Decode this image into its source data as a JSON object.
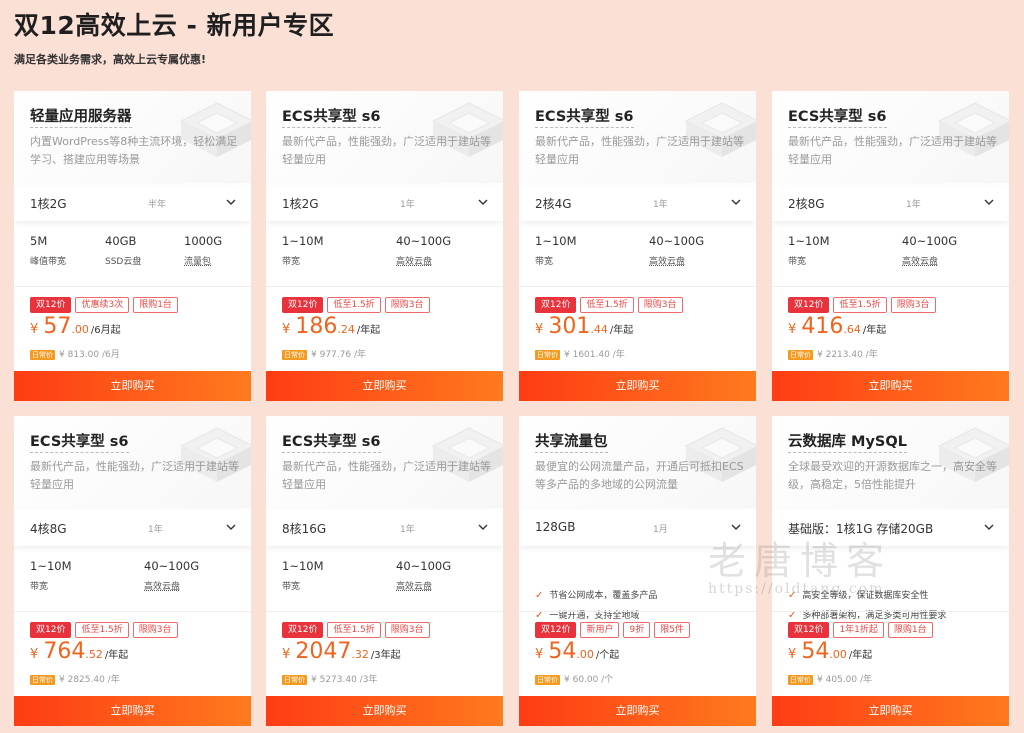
{
  "header": {
    "title": "双12高效上云 - 新用户专区",
    "subtitle": "满足各类业务需求，高效上云专属优惠!"
  },
  "buy_label": "立即购买",
  "orig_badge": "日常价",
  "colors": {
    "accent": "#f0641e",
    "tag_red": "#e8323c",
    "button_start": "#ff3c14",
    "button_end": "#ff7a1e",
    "background": "#fbe0d6"
  },
  "cards": [
    {
      "name": "轻量应用服务器",
      "desc": "内置WordPress等8种主流环境，轻松满足学习、搭建应用等场景",
      "spec": "1核2G",
      "duration": "半年",
      "specs": [
        {
          "v": "5M",
          "l": "峰值带宽"
        },
        {
          "v": "40GB",
          "l": "SSD云盘"
        },
        {
          "v": "1000G",
          "l": "流量包"
        }
      ],
      "tags": [
        "双12价",
        "优惠续3次",
        "限购1台"
      ],
      "price_cur": "¥",
      "price_int": "57",
      "price_dec": ".00",
      "price_unit": "/6月起",
      "orig": "¥ 813.00 /6月"
    },
    {
      "name": "ECS共享型 s6",
      "desc": "最新代产品，性能强劲，广泛适用于建站等轻量应用",
      "spec": "1核2G",
      "duration": "1年",
      "specs": [
        {
          "v": "1~10M",
          "l": "带宽"
        },
        {
          "v": "40~100G",
          "l": "高效云盘"
        }
      ],
      "tags": [
        "双12价",
        "低至1.5折",
        "限购3台"
      ],
      "price_cur": "¥",
      "price_int": "186",
      "price_dec": ".24",
      "price_unit": "/年起",
      "orig": "¥ 977.76 /年"
    },
    {
      "name": "ECS共享型 s6",
      "desc": "最新代产品，性能强劲，广泛适用于建站等轻量应用",
      "spec": "2核4G",
      "duration": "1年",
      "specs": [
        {
          "v": "1~10M",
          "l": "带宽"
        },
        {
          "v": "40~100G",
          "l": "高效云盘"
        }
      ],
      "tags": [
        "双12价",
        "低至1.5折",
        "限购3台"
      ],
      "price_cur": "¥",
      "price_int": "301",
      "price_dec": ".44",
      "price_unit": "/年起",
      "orig": "¥ 1601.40 /年"
    },
    {
      "name": "ECS共享型 s6",
      "desc": "最新代产品，性能强劲，广泛适用于建站等轻量应用",
      "spec": "2核8G",
      "duration": "1年",
      "specs": [
        {
          "v": "1~10M",
          "l": "带宽"
        },
        {
          "v": "40~100G",
          "l": "高效云盘"
        }
      ],
      "tags": [
        "双12价",
        "低至1.5折",
        "限购3台"
      ],
      "price_cur": "¥",
      "price_int": "416",
      "price_dec": ".64",
      "price_unit": "/年起",
      "orig": "¥ 2213.40 /年"
    },
    {
      "name": "ECS共享型 s6",
      "desc": "最新代产品，性能强劲，广泛适用于建站等轻量应用",
      "spec": "4核8G",
      "duration": "1年",
      "specs": [
        {
          "v": "1~10M",
          "l": "带宽"
        },
        {
          "v": "40~100G",
          "l": "高效云盘"
        }
      ],
      "tags": [
        "双12价",
        "低至1.5折",
        "限购3台"
      ],
      "price_cur": "¥",
      "price_int": "764",
      "price_dec": ".52",
      "price_unit": "/年起",
      "orig": "¥ 2825.40 /年"
    },
    {
      "name": "ECS共享型 s6",
      "desc": "最新代产品，性能强劲，广泛适用于建站等轻量应用",
      "spec": "8核16G",
      "duration": "1年",
      "specs": [
        {
          "v": "1~10M",
          "l": "带宽"
        },
        {
          "v": "40~100G",
          "l": "高效云盘"
        }
      ],
      "tags": [
        "双12价",
        "低至1.5折",
        "限购3台"
      ],
      "price_cur": "¥",
      "price_int": "2047",
      "price_dec": ".32",
      "price_unit": "/3年起",
      "orig": "¥ 5273.40 /3年"
    },
    {
      "name": "共享流量包",
      "desc": "最便宜的公网流量产品，开通后可抵扣ECS等多产品的多地域的公网流量",
      "spec": "128GB",
      "duration": "1月",
      "features": [
        "节省公网成本，覆盖多产品",
        "一键开通，支持全地域"
      ],
      "tags": [
        "双12价",
        "新用户",
        "9折",
        "限5件"
      ],
      "price_cur": "¥",
      "price_int": "54",
      "price_dec": ".00",
      "price_unit": "/个起",
      "orig": "¥ 60.00 /个"
    },
    {
      "name": "云数据库 MySQL",
      "desc": "全球最受欢迎的开源数据库之一，高安全等级，高稳定，5倍性能提升",
      "spec": "基础版：1核1G 存储20GB",
      "duration": "",
      "features": [
        "高安全等级，保证数据库安全性",
        "多种部署架构，满足多类可用性要求"
      ],
      "tags": [
        "双12价",
        "1年1折起",
        "限购1台"
      ],
      "price_cur": "¥",
      "price_int": "54",
      "price_dec": ".00",
      "price_unit": "/年起",
      "orig": "¥ 405.00 /年"
    }
  ],
  "watermark": {
    "big": "老唐博客",
    "small": "https://oldtang.com"
  }
}
